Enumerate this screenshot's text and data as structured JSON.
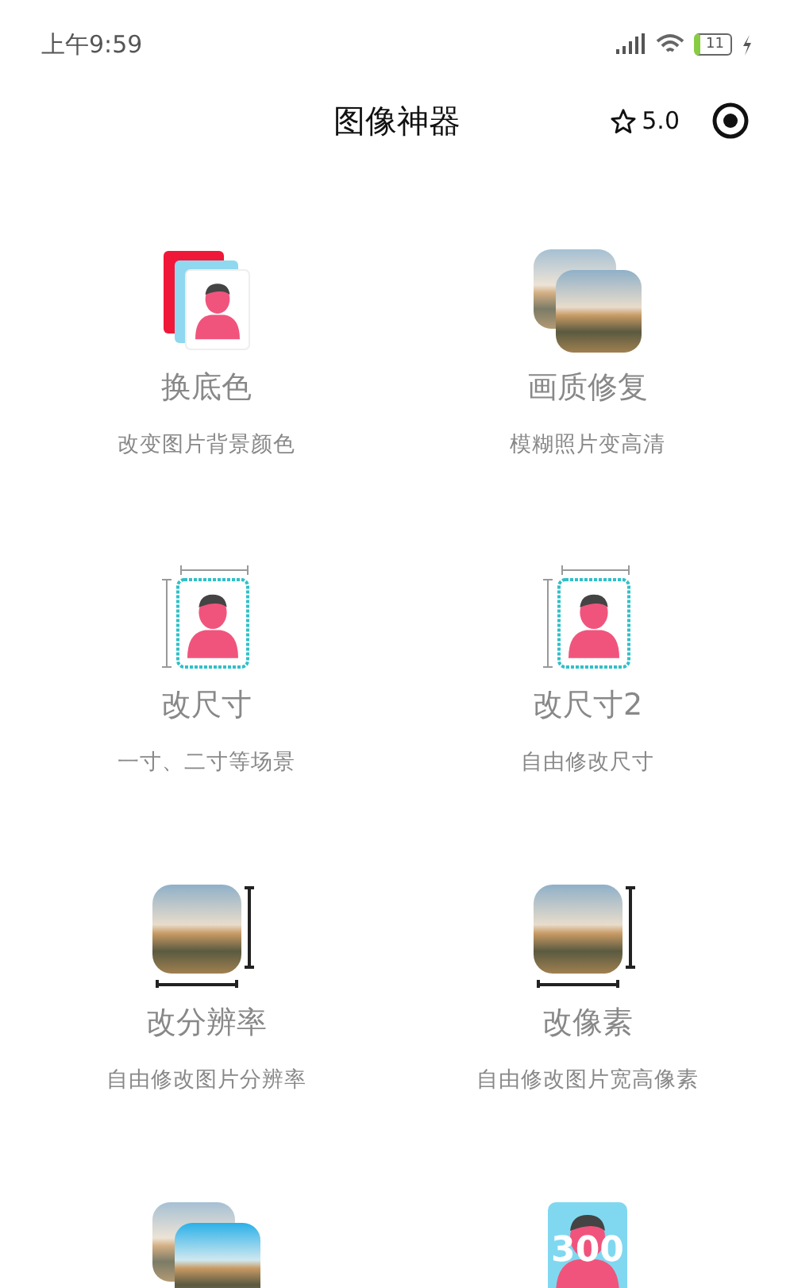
{
  "status_bar": {
    "time": "上午9:59",
    "battery": "11"
  },
  "nav": {
    "title": "图像神器",
    "rating": "5.0"
  },
  "tools": [
    {
      "kind": "bg-swap",
      "title": "换底色",
      "subtitle": "改变图片背景颜色"
    },
    {
      "kind": "photo-stack",
      "title": "画质修复",
      "subtitle": "模糊照片变高清"
    },
    {
      "kind": "id-size",
      "title": "改尺寸",
      "subtitle": "一寸、二寸等场景"
    },
    {
      "kind": "id-size",
      "title": "改尺寸2",
      "subtitle": "自由修改尺寸"
    },
    {
      "kind": "photo-resize",
      "title": "改分辨率",
      "subtitle": "自由修改图片分辨率"
    },
    {
      "kind": "photo-resize",
      "title": "改像素",
      "subtitle": "自由修改图片宽高像素"
    },
    {
      "kind": "photo-stack-bright"
    },
    {
      "kind": "dpi",
      "badge": "300"
    }
  ]
}
